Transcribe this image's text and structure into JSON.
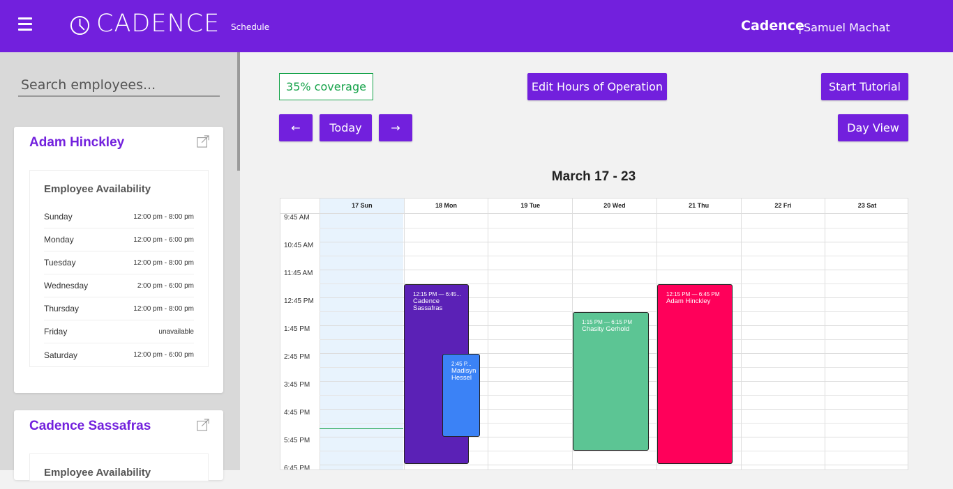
{
  "header": {
    "logo_text": "CADENCE",
    "logo_sub": "Schedule",
    "app_name": "Cadence",
    "separator": "|",
    "user_name": "Samuel Machat",
    "icons": [
      "hamburger-icon",
      "clock-logo-icon"
    ]
  },
  "sidebar": {
    "search_placeholder": "Search employees...",
    "employees": [
      {
        "name": "Adam Hinckley",
        "availability_title": "Employee Availability",
        "availability": [
          {
            "day": "Sunday",
            "hours": "12:00 pm - 8:00 pm"
          },
          {
            "day": "Monday",
            "hours": "12:00 pm - 6:00 pm"
          },
          {
            "day": "Tuesday",
            "hours": "12:00 pm - 8:00 pm"
          },
          {
            "day": "Wednesday",
            "hours": "2:00 pm - 6:00 pm"
          },
          {
            "day": "Thursday",
            "hours": "12:00 pm - 8:00 pm"
          },
          {
            "day": "Friday",
            "hours": "unavailable"
          },
          {
            "day": "Saturday",
            "hours": "12:00 pm - 6:00 pm"
          }
        ]
      },
      {
        "name": "Cadence Sassafras",
        "availability_title": "Employee Availability"
      }
    ]
  },
  "toolbar": {
    "coverage": "35% coverage",
    "edit_hours": "Edit Hours of Operation",
    "start_tutorial": "Start Tutorial",
    "prev": "←",
    "today": "Today",
    "next": "→",
    "day_view": "Day View"
  },
  "calendar": {
    "title": "March 17 - 23",
    "days": [
      "17 Sun",
      "18 Mon",
      "19 Tue",
      "20 Wed",
      "21 Thu",
      "22 Fri",
      "23 Sat"
    ],
    "today_index": 0,
    "times": [
      "9:45 AM",
      "10:45 AM",
      "11:45 AM",
      "12:45 PM",
      "1:45 PM",
      "2:45 PM",
      "3:45 PM",
      "4:45 PM",
      "5:45 PM",
      "6:45 PM"
    ],
    "events": [
      {
        "day": 1,
        "time": "12:15 PM — 6:45...",
        "name": "Cadence Sassafras",
        "color": "#5b21b6"
      },
      {
        "day": 1,
        "time": "2:45 P...",
        "name": "Madisyn Hessel",
        "color": "#3b82f6"
      },
      {
        "day": 3,
        "time": "1:15 PM — 6:15 PM",
        "name": "Chasity Gerhold",
        "color": "#5cc594"
      },
      {
        "day": 4,
        "time": "12:15 PM — 6:45 PM",
        "name": "Adam Hinckley",
        "color": "#ff005a"
      }
    ]
  },
  "colors": {
    "brand": "#7220dd",
    "coverage_green": "#16a34a",
    "today_bg": "#e8f3fd"
  }
}
